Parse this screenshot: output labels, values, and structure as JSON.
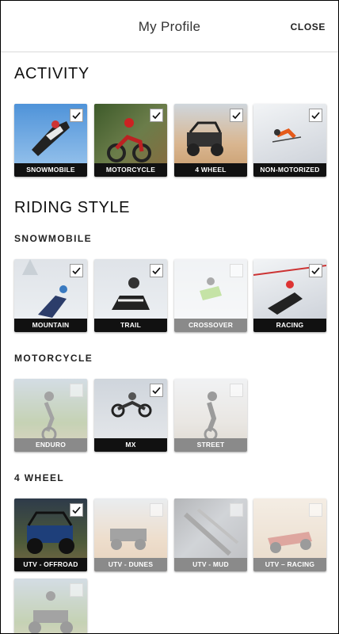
{
  "header": {
    "title": "My Profile",
    "close_label": "CLOSE"
  },
  "activity": {
    "heading": "ACTIVITY",
    "tiles": [
      {
        "label": "SNOWMOBILE",
        "checked": true
      },
      {
        "label": "MOTORCYCLE",
        "checked": true
      },
      {
        "label": "4 WHEEL",
        "checked": true
      },
      {
        "label": "NON-MOTORIZED",
        "checked": true
      }
    ]
  },
  "riding_style": {
    "heading": "RIDING STYLE",
    "snowmobile": {
      "heading": "SNOWMOBILE",
      "tiles": [
        {
          "label": "MOUNTAIN",
          "checked": true
        },
        {
          "label": "TRAIL",
          "checked": true
        },
        {
          "label": "CROSSOVER",
          "checked": false
        },
        {
          "label": "RACING",
          "checked": true
        }
      ]
    },
    "motorcycle": {
      "heading": "MOTORCYCLE",
      "tiles": [
        {
          "label": "ENDURO",
          "checked": false
        },
        {
          "label": "MX",
          "checked": true
        },
        {
          "label": "STREET",
          "checked": false
        }
      ]
    },
    "four_wheel": {
      "heading": "4 WHEEL",
      "tiles": [
        {
          "label": "UTV - OFFROAD",
          "checked": true
        },
        {
          "label": "UTV - DUNES",
          "checked": false
        },
        {
          "label": "UTV - MUD",
          "checked": false
        },
        {
          "label": "UTV – RACING",
          "checked": false
        },
        {
          "label": "",
          "checked": false
        }
      ]
    }
  }
}
